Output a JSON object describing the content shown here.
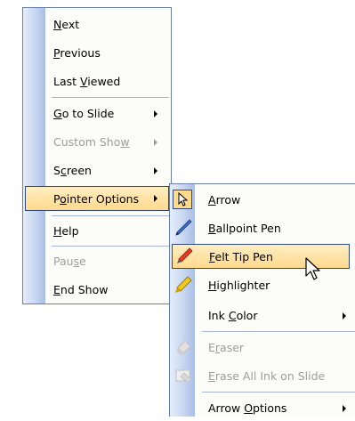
{
  "main_menu": {
    "items": [
      {
        "pre": "",
        "key": "N",
        "post": "ext"
      },
      {
        "pre": "",
        "key": "P",
        "post": "revious"
      },
      {
        "pre": "Last ",
        "key": "V",
        "post": "iewed"
      },
      {
        "pre": "",
        "key": "G",
        "post": "o to Slide"
      },
      {
        "pre": "Custom Sho",
        "key": "w",
        "post": ""
      },
      {
        "pre": "S",
        "key": "c",
        "post": "reen"
      },
      {
        "pre": "P",
        "key": "o",
        "post": "inter Options"
      },
      {
        "pre": "",
        "key": "H",
        "post": "elp"
      },
      {
        "pre": "Pau",
        "key": "s",
        "post": "e"
      },
      {
        "pre": "",
        "key": "E",
        "post": "nd Show"
      }
    ]
  },
  "pointer_menu": {
    "items": [
      {
        "pre": "",
        "key": "A",
        "post": "rrow",
        "icon": "arrow-cursor-icon"
      },
      {
        "pre": "",
        "key": "B",
        "post": "allpoint Pen",
        "icon": "ballpoint-pen-icon"
      },
      {
        "pre": "",
        "key": "F",
        "post": "elt Tip Pen",
        "icon": "felt-tip-pen-icon"
      },
      {
        "pre": "",
        "key": "H",
        "post": "ighlighter",
        "icon": "highlighter-icon"
      },
      {
        "pre": "Ink ",
        "key": "C",
        "post": "olor"
      },
      {
        "pre": "E",
        "key": "r",
        "post": "aser",
        "icon": "eraser-icon"
      },
      {
        "pre": "",
        "key": "E",
        "post": "rase All Ink on Slide",
        "icon": "erase-all-ink-icon"
      },
      {
        "pre": "Arrow ",
        "key": "O",
        "post": "ptions"
      }
    ]
  },
  "colors": {
    "highlight_top": "#ffeec2",
    "highlight_bottom": "#ffd98c",
    "border": "#6a7fa8",
    "disabled": "#9d9d9d"
  }
}
